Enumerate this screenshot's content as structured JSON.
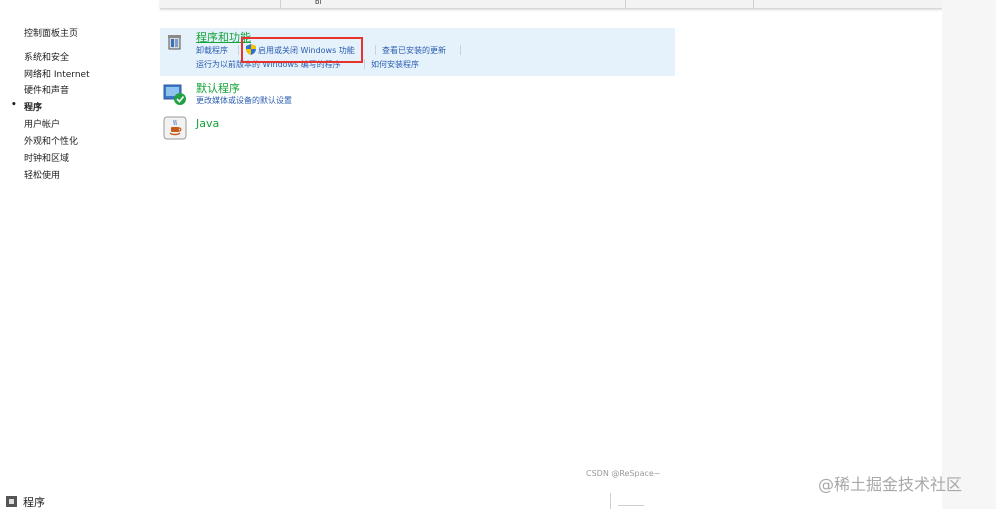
{
  "topbar": {
    "fragment": "bl"
  },
  "sidebar": {
    "home": "控制面板主页",
    "items": [
      {
        "label": "系统和安全",
        "current": false
      },
      {
        "label": "网络和 Internet",
        "current": false
      },
      {
        "label": "硬件和声音",
        "current": false
      },
      {
        "label": "程序",
        "current": true,
        "bullet": "•"
      },
      {
        "label": "用户帐户",
        "current": false
      },
      {
        "label": "外观和个性化",
        "current": false
      },
      {
        "label": "时钟和区域",
        "current": false
      },
      {
        "label": "轻松使用",
        "current": false
      }
    ]
  },
  "categories": {
    "programs": {
      "title": "程序和功能",
      "links": [
        "卸载程序",
        "启用或关闭 Windows 功能",
        "查看已安装的更新",
        "运行为以前版本的 Windows 编写的程序",
        "如何安装程序"
      ]
    },
    "default_programs": {
      "title": "默认程序",
      "links": [
        "更改媒体或设备的默认设置"
      ]
    },
    "java": {
      "title": "Java"
    }
  },
  "watermarks": {
    "csdn": "CSDN @ReSpace~",
    "juejin": "@稀土掘金技术社区"
  },
  "taskbar": {
    "label": "程序"
  },
  "colors": {
    "highlight_border": "#e8322e",
    "panel_bg": "#e5f1fb",
    "title_green": "#15a33a",
    "link_blue": "#2a5db0"
  }
}
